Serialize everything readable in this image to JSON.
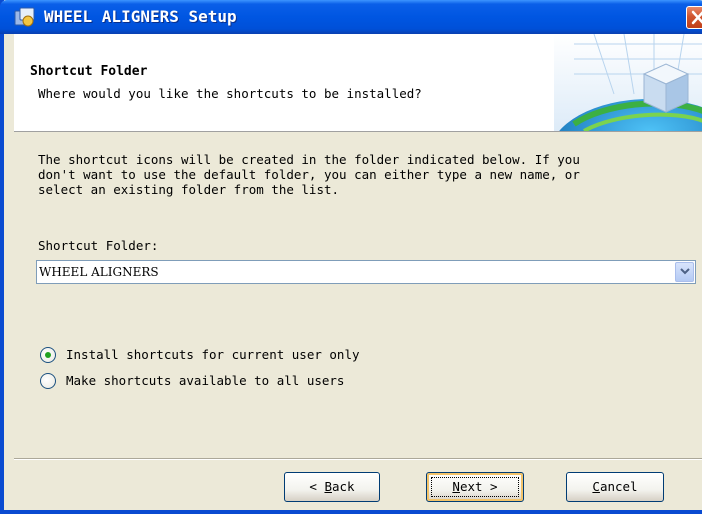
{
  "window": {
    "title": "WHEEL ALIGNERS Setup"
  },
  "header": {
    "title": "Shortcut Folder",
    "subtitle": "Where would you like the shortcuts to be installed?"
  },
  "body": {
    "description": "The shortcut icons will be created in the folder indicated below. If you\ndon't want to use the default folder, you can either type a new name, or\nselect an existing folder from the list.",
    "folder_label": "Shortcut Folder:",
    "folder_value": "WHEEL ALIGNERS"
  },
  "radios": [
    {
      "label": "Install shortcuts for current user only",
      "selected": true
    },
    {
      "label": "Make shortcuts available to all users",
      "selected": false
    }
  ],
  "buttons": {
    "back_prefix": "< ",
    "back_accel": "B",
    "back_rest": "ack",
    "next_accel": "N",
    "next_rest": "ext >",
    "cancel_accel": "C",
    "cancel_rest": "ancel"
  },
  "icons": {
    "title_icon": "setup-icon",
    "close": "close-icon",
    "dropdown": "chevron-down-icon",
    "header_graphic": "cube-globe-icon"
  },
  "colors": {
    "titlebar": "#0056E2",
    "window_bg": "#ECE9D8",
    "close_btn": "#D0552F",
    "radio_dot": "#21A121"
  }
}
